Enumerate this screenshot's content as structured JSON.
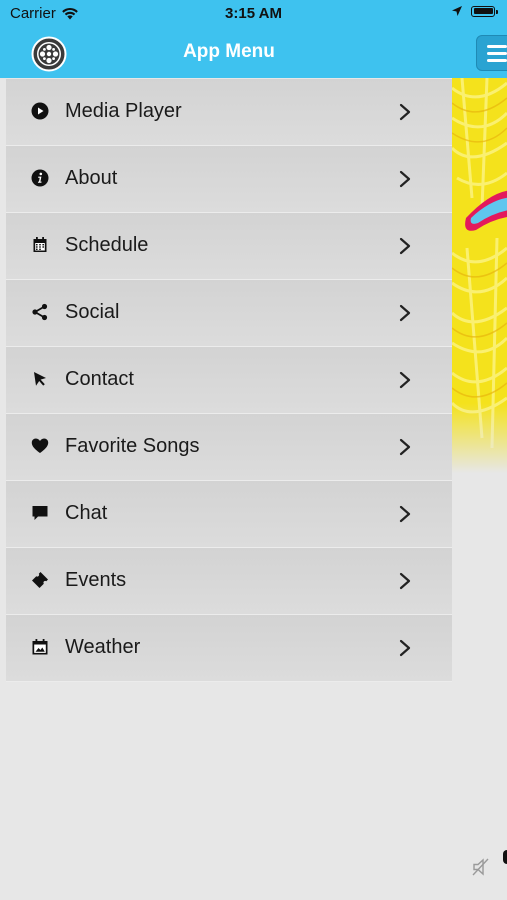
{
  "status_bar": {
    "carrier": "Carrier",
    "time": "3:15 AM"
  },
  "nav": {
    "title": "App Menu",
    "left_icon": "film-reel-icon",
    "right_icon": "hamburger-menu-icon",
    "bar_color": "#3ec2ef"
  },
  "menu": {
    "items": [
      {
        "label": "Media Player",
        "icon": "play-circle-icon"
      },
      {
        "label": "About",
        "icon": "info-icon"
      },
      {
        "label": "Schedule",
        "icon": "calendar-icon"
      },
      {
        "label": "Social",
        "icon": "share-icon"
      },
      {
        "label": "Contact",
        "icon": "cursor-arrow-icon"
      },
      {
        "label": "Favorite Songs",
        "icon": "heart-icon"
      },
      {
        "label": "Chat",
        "icon": "chat-bubble-icon"
      },
      {
        "label": "Events",
        "icon": "ticket-icon"
      },
      {
        "label": "Weather",
        "icon": "weather-calendar-icon"
      }
    ]
  }
}
